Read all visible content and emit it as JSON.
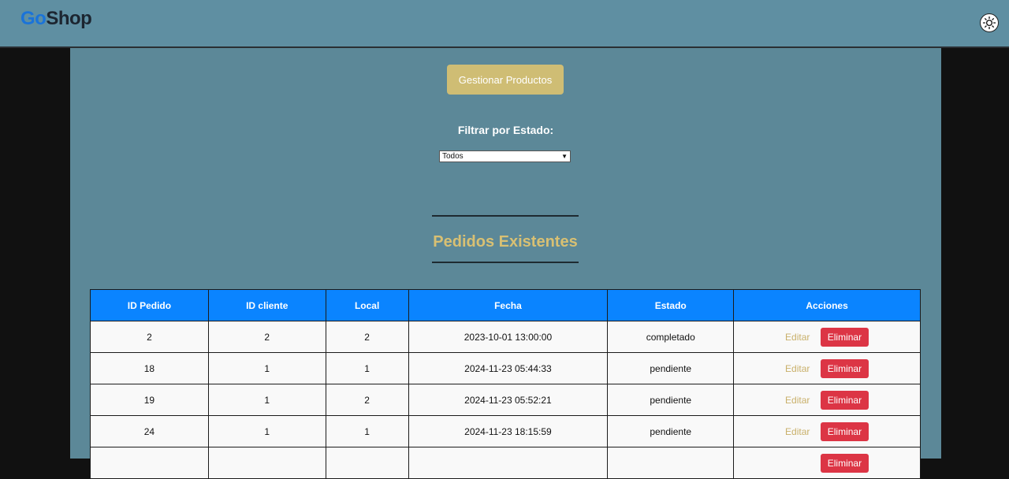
{
  "header": {
    "logo_part1": "Go",
    "logo_part2": "Shop",
    "theme_toggle_icon": "sun-icon"
  },
  "actions": {
    "manage_products_label": "Gestionar Productos"
  },
  "filter": {
    "label": "Filtrar por Estado:",
    "selected": "Todos"
  },
  "section": {
    "title": "Pedidos Existentes"
  },
  "table": {
    "columns": [
      "ID Pedido",
      "ID cliente",
      "Local",
      "Fecha",
      "Estado",
      "Acciones"
    ],
    "edit_label": "Editar",
    "delete_label": "Eliminar",
    "rows": [
      {
        "id": "2",
        "client": "2",
        "local": "2",
        "date": "2023-10-01 13:00:00",
        "status": "completado"
      },
      {
        "id": "18",
        "client": "1",
        "local": "1",
        "date": "2024-11-23 05:44:33",
        "status": "pendiente"
      },
      {
        "id": "19",
        "client": "1",
        "local": "2",
        "date": "2024-11-23 05:52:21",
        "status": "pendiente"
      },
      {
        "id": "24",
        "client": "1",
        "local": "1",
        "date": "2024-11-23 18:15:59",
        "status": "pendiente"
      },
      {
        "id": "",
        "client": "",
        "local": "",
        "date": "",
        "status": ""
      }
    ]
  },
  "colors": {
    "header_bg": "#5f8fa2",
    "panel_bg": "#5c8898",
    "accent_gold": "#cfbd74",
    "table_header": "#0a84ff",
    "delete_red": "#dc3545"
  }
}
